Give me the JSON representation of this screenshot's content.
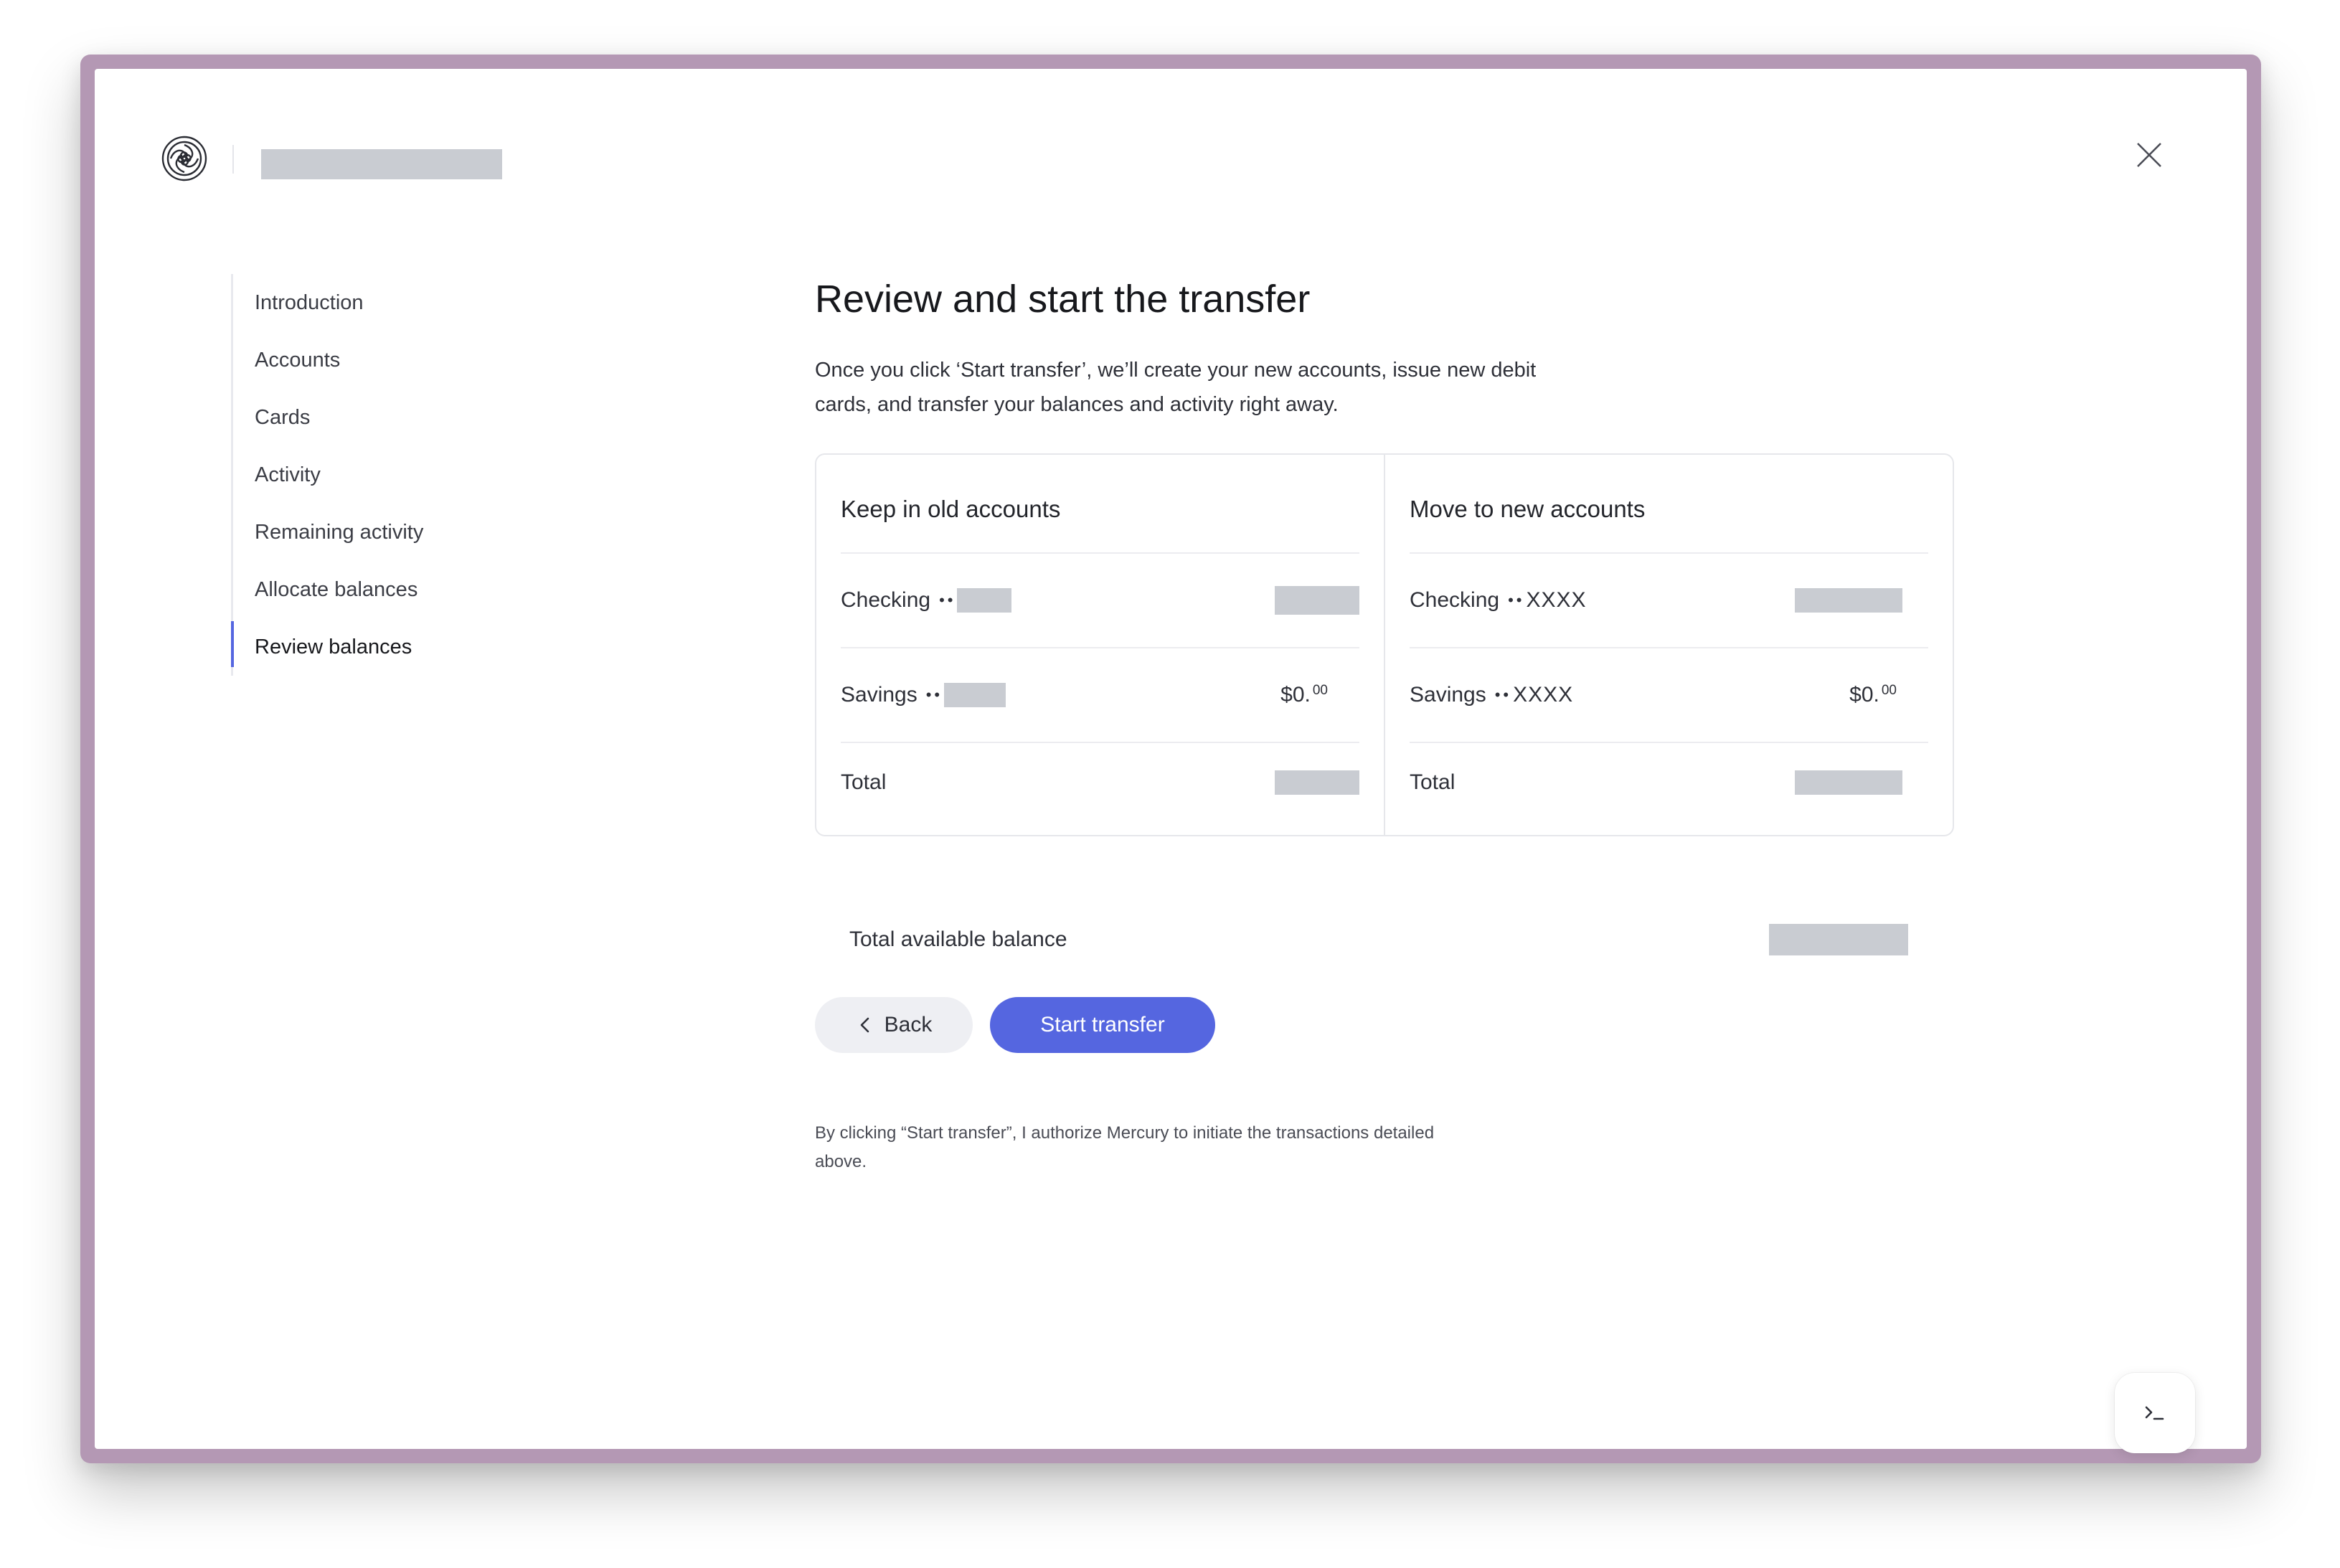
{
  "header": {
    "logo_icon": "mercury-logo-icon",
    "close_icon": "close-icon"
  },
  "steps": [
    {
      "label": "Introduction",
      "active": false
    },
    {
      "label": "Accounts",
      "active": false
    },
    {
      "label": "Cards",
      "active": false
    },
    {
      "label": "Activity",
      "active": false
    },
    {
      "label": "Remaining activity",
      "active": false
    },
    {
      "label": "Allocate balances",
      "active": false
    },
    {
      "label": "Review balances",
      "active": true
    }
  ],
  "main": {
    "title": "Review and start the transfer",
    "description": "Once you click ‘Start transfer’, we’ll create your new accounts, issue new debit cards, and transfer your balances and activity right away.",
    "old_accounts": {
      "title": "Keep in old accounts",
      "checking_label": "Checking",
      "savings_label": "Savings",
      "savings_dollars": "$0.",
      "savings_cents": "00",
      "total_label": "Total"
    },
    "new_accounts": {
      "title": "Move to new accounts",
      "checking_label": "Checking",
      "checking_mask": "XXXX",
      "savings_label": "Savings",
      "savings_mask": "XXXX",
      "savings_dollars": "$0.",
      "savings_cents": "00",
      "total_label": "Total"
    },
    "total_available_label": "Total available balance",
    "back_label": "Back",
    "start_label": "Start transfer",
    "disclaimer": "By clicking “Start transfer”, I authorize Mercury to initiate the transactions detailed above."
  },
  "colors": {
    "accent": "#5566e0",
    "frame": "#b498b4",
    "redaction": "#c9ccd2"
  }
}
